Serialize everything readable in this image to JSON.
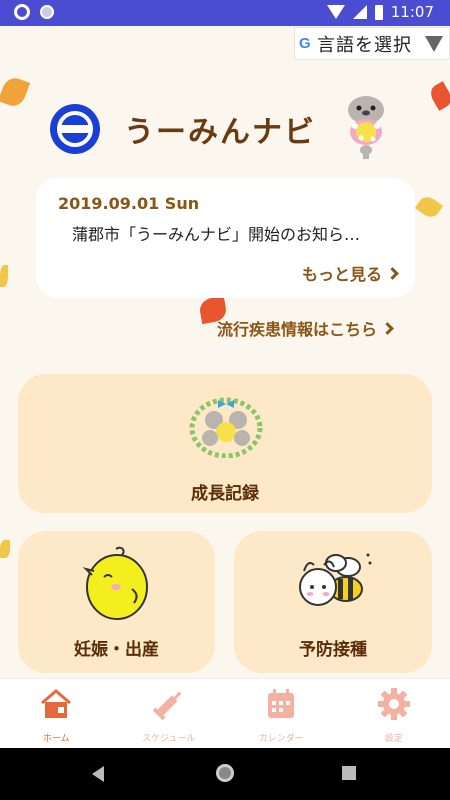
{
  "status_bar": {
    "time": "11:07"
  },
  "translate": {
    "label": "言語を選択",
    "logo": "G"
  },
  "header": {
    "title": "うーみんナビ",
    "logo_icon": "umin-logo-icon",
    "mascot_icon": "mascot-icon"
  },
  "news": {
    "date": "2019.09.01 Sun",
    "headline": "蒲郡市「うーみんナビ」開始のお知ら…",
    "more_label": "もっと見る"
  },
  "disease_link": {
    "label": "流行疾患情報はこちら"
  },
  "tiles": {
    "growth": {
      "label": "成長記録",
      "icon": "wreath-mascots-icon"
    },
    "pregnancy": {
      "label": "妊娠・出産",
      "icon": "chick-icon"
    },
    "vaccine": {
      "label": "予防接種",
      "icon": "bee-icon"
    }
  },
  "bottom_nav": {
    "items": [
      {
        "label": "ホーム",
        "icon": "home-icon",
        "active": true
      },
      {
        "label": "スケジュール",
        "icon": "syringe-icon",
        "active": false
      },
      {
        "label": "カレンダー",
        "icon": "calendar-icon",
        "active": false
      },
      {
        "label": "設定",
        "icon": "gear-icon",
        "active": false
      }
    ]
  },
  "colors": {
    "status_bar": "#4a4cd2",
    "accent_brown": "#8a5617",
    "tile_bg": "#fde8c7",
    "nav_active": "#e56a3a",
    "nav_inactive": "#f4b0a0"
  }
}
